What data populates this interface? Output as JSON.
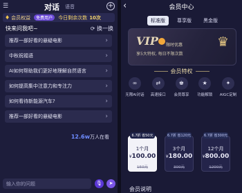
{
  "left": {
    "menu_icon": "menu-icon",
    "title": "对话",
    "subtitle": "语音",
    "vip_bar": {
      "label": "会员权益",
      "badge": "免费用户",
      "remaining_label": "今日剩余次数",
      "remaining_count": "10次"
    },
    "quick": {
      "title": "快来问我吧~",
      "refresh": "换一换"
    },
    "questions": [
      "推荐一部好看的悬疑电影",
      "中秋祝福语",
      "AI如何帮助我们更好地理解自然语言",
      "如何提高集中注意力和专注力",
      "如何看待新能源汽车?",
      "推荐一部好看的悬疑电影"
    ],
    "users": {
      "count": "12.6w",
      "suffix": "万人在看"
    },
    "input": {
      "placeholder": "输入你的问题"
    }
  },
  "right": {
    "title": "会员中心",
    "tabs": [
      "标准版",
      "尊享版",
      "黑金版"
    ],
    "active_tab": 0,
    "vip_card": {
      "logo": "VIP",
      "limit": "限时优惠",
      "perk": "享5大特权, 每日不限次数"
    },
    "privilege_title": "会员特权",
    "privileges": [
      {
        "icon": "infinity-icon",
        "label": "无限AI对话"
      },
      {
        "icon": "api-icon",
        "label": "高速接口"
      },
      {
        "icon": "crown-icon",
        "label": "会员尊享"
      },
      {
        "icon": "star-icon",
        "label": "功能解锁"
      },
      {
        "icon": "magic-icon",
        "label": "AIGC定制"
      }
    ],
    "plans": [
      {
        "tag": "6.7折 省50元",
        "duration": "1个月",
        "price": "100.00",
        "original": "150元",
        "selected": true
      },
      {
        "tag": "6.7折 省120元",
        "duration": "3个月",
        "price": "180.00",
        "original": "300元",
        "selected": false
      },
      {
        "tag": "6.7折 省300元",
        "duration": "12个月",
        "price": "800.00",
        "original": "1200元",
        "selected": false
      }
    ],
    "currency_symbol": "¥",
    "footer": "会员说明"
  },
  "colors": {
    "accent": "#6c4ad9",
    "gold": "#e8d8a8",
    "panel": "#1d1d3b"
  }
}
